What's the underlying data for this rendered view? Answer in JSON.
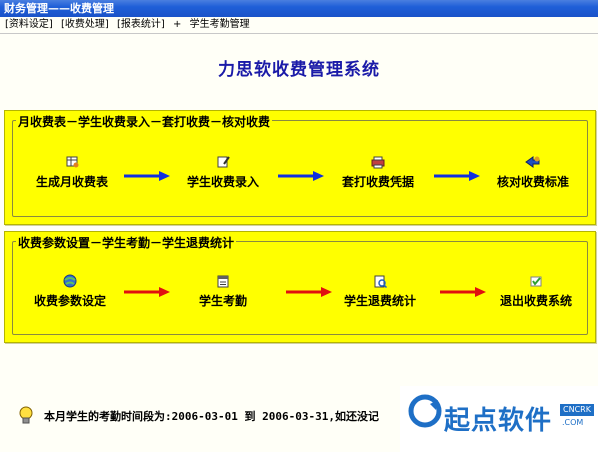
{
  "window": {
    "title": "财务管理——收费管理"
  },
  "menu": {
    "items": [
      "[资料设定]",
      "[收费处理]",
      "[报表统计]",
      "+",
      "学生考勤管理"
    ]
  },
  "app_title": "力思软收费管理系统",
  "panel1": {
    "legend": "月收费表－学生收费录入－套打收费－核对收费",
    "steps": [
      "生成月收费表",
      "学生收费录入",
      "套打收费凭据",
      "核对收费标准"
    ],
    "arrow_color": "#1030e0"
  },
  "panel2": {
    "legend": "收费参数设置－学生考勤－学生退费统计",
    "steps": [
      "收费参数设定",
      "学生考勤",
      "学生退费统计",
      "退出收费系统"
    ],
    "arrow_color": "#e01010"
  },
  "footer": {
    "text": "本月学生的考勤时间段为:2006-03-01  到  2006-03-31,如还没记"
  },
  "watermark": {
    "text": "起点软件",
    "badge": "CNCRK",
    "domain": ".COM"
  },
  "colors": {
    "panel_bg": "#ffff00",
    "title_color": "#1a1aa8"
  }
}
